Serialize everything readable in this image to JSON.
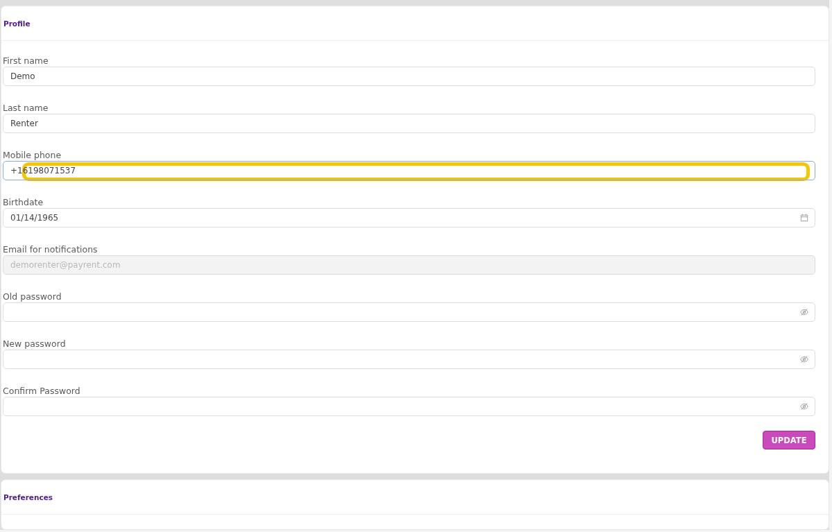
{
  "sections": [
    {
      "title": "Profile",
      "fields": [
        {
          "label": "First name",
          "kind": "text",
          "value": "Demo",
          "focused": false,
          "disabled": false,
          "highlighted": false
        },
        {
          "label": "Last name",
          "kind": "text",
          "value": "Renter",
          "focused": false,
          "disabled": false,
          "highlighted": false
        },
        {
          "label": "Mobile phone",
          "kind": "text",
          "value": "+16198071537",
          "focused": true,
          "disabled": false,
          "highlighted": true
        },
        {
          "label": "Birthdate",
          "kind": "date",
          "value": "01/14/1965",
          "focused": false,
          "disabled": false,
          "highlighted": false
        },
        {
          "label": "Email for notifications",
          "kind": "text",
          "value": "demorenter@payrent.com",
          "focused": false,
          "disabled": true,
          "highlighted": false
        },
        {
          "label": "Old password",
          "kind": "password",
          "focused": false,
          "disabled": false,
          "highlighted": false
        },
        {
          "label": "New password",
          "kind": "password",
          "focused": false,
          "disabled": false,
          "highlighted": false
        },
        {
          "label": "Confirm Password",
          "kind": "password",
          "focused": false,
          "disabled": false,
          "highlighted": false
        }
      ],
      "buttons": [
        {
          "label": "UPDATE"
        }
      ]
    },
    {
      "title": "Preferences"
    }
  ]
}
